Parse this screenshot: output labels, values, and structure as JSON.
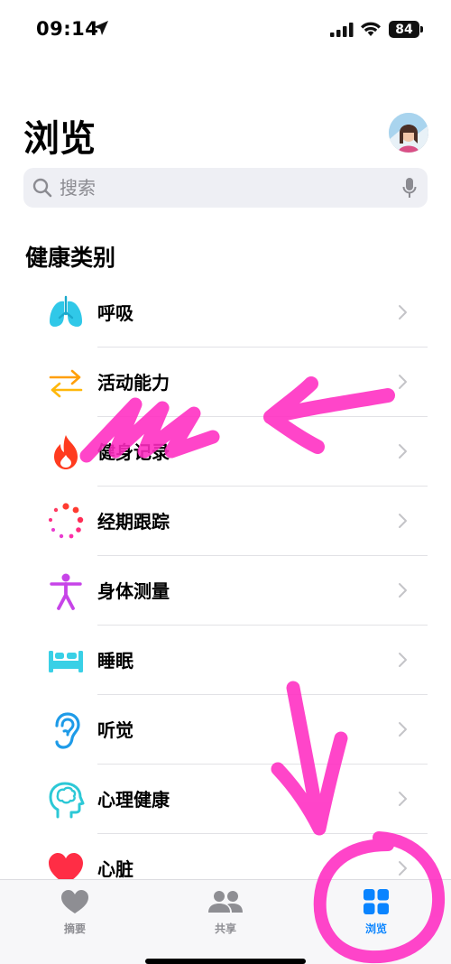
{
  "status_bar": {
    "time": "09:14",
    "battery": "84"
  },
  "header": {
    "title": "浏览"
  },
  "search": {
    "placeholder": "搜索"
  },
  "section": {
    "title": "健康类别"
  },
  "categories": [
    {
      "label": "呼吸",
      "icon": "lungs-icon",
      "color": "#30c8e8"
    },
    {
      "label": "活动能力",
      "icon": "arrows-swap-icon",
      "color": "#ff9f0a"
    },
    {
      "label": "健身记录",
      "icon": "flame-icon",
      "color": "#ff3b1f"
    },
    {
      "label": "经期跟踪",
      "icon": "cycle-dots-icon",
      "color": "#ff2d55"
    },
    {
      "label": "身体测量",
      "icon": "body-figure-icon",
      "color": "#c744e8"
    },
    {
      "label": "睡眠",
      "icon": "bed-icon",
      "color": "#39d0e6"
    },
    {
      "label": "听觉",
      "icon": "ear-icon",
      "color": "#1e9be8"
    },
    {
      "label": "心理健康",
      "icon": "head-brain-icon",
      "color": "#2cc8d6"
    },
    {
      "label": "心脏",
      "icon": "heart-icon",
      "color": "#ff2d45"
    }
  ],
  "tab_bar": {
    "tabs": [
      {
        "label": "摘要",
        "icon": "heart-tab-icon",
        "active": false
      },
      {
        "label": "共享",
        "icon": "people-tab-icon",
        "active": false
      },
      {
        "label": "浏览",
        "icon": "grid-tab-icon",
        "active": true
      }
    ]
  },
  "colors": {
    "accent": "#0a84ff",
    "annotation": "#ff2bc2"
  }
}
